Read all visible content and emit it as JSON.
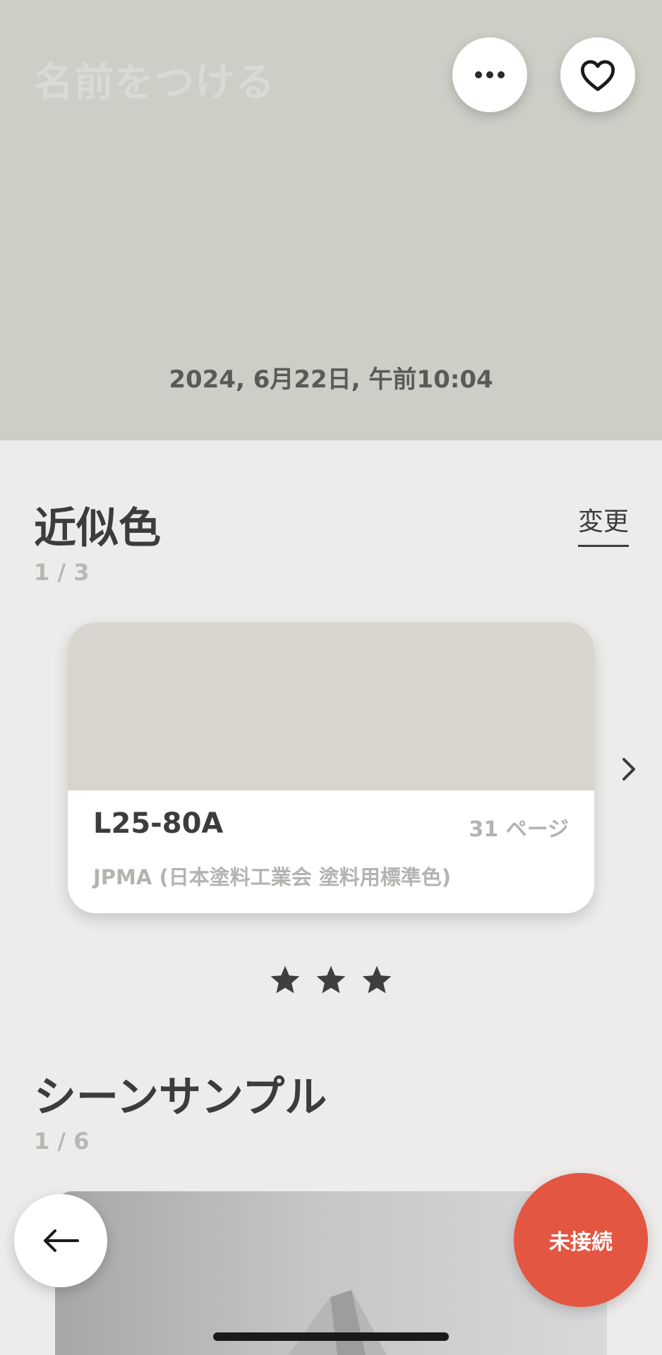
{
  "header": {
    "name_placeholder": "名前をつける",
    "datetime": "2024, 6月22日, 午前10:04",
    "background_color": "#cecdc6",
    "more_icon": "more-horizontal-icon",
    "favorite_icon": "heart-outline-icon"
  },
  "similar_colors": {
    "title": "近似色",
    "count": "1 / 3",
    "change_label": "変更",
    "card": {
      "swatch_color": "#d7d5ce",
      "code": "L25-80A",
      "page": "31 ページ",
      "source": "JPMA (日本塗料工業会 塗料用標準色)"
    },
    "next_icon": "chevron-right-icon",
    "rating": 3
  },
  "scene_sample": {
    "title": "シーンサンプル",
    "count": "1 / 6"
  },
  "footer": {
    "back_icon": "arrow-left-icon",
    "status_label": "未接続",
    "status_color": "#e35642"
  }
}
